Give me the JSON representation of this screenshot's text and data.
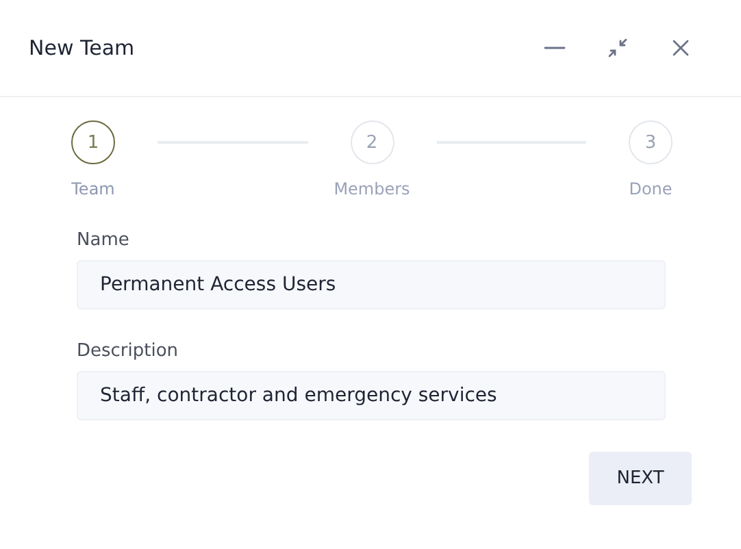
{
  "window": {
    "title": "New Team"
  },
  "steps": [
    {
      "number": "1",
      "label": "Team",
      "selected": true
    },
    {
      "number": "2",
      "label": "Members",
      "selected": false
    },
    {
      "number": "3",
      "label": "Done",
      "selected": false
    }
  ],
  "fields": [
    {
      "label": "Name",
      "value": "Permanent Access Users"
    },
    {
      "label": "Description",
      "value": "Staff, contractor and emergency services"
    }
  ],
  "buttons": [
    {
      "label": "NEXT"
    }
  ]
}
